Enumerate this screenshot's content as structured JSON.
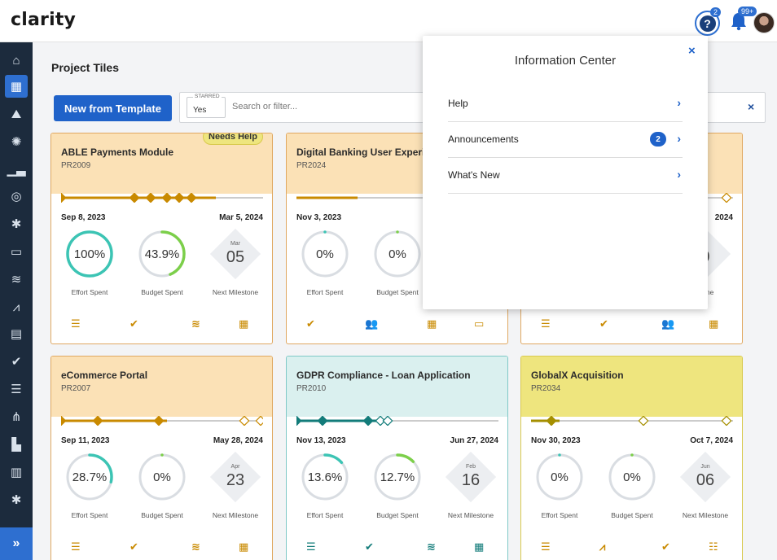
{
  "app": {
    "logo": "clarity",
    "help_badge": "2",
    "notif_badge": "99+"
  },
  "nav": {
    "icons": [
      "home-icon",
      "tiles-icon",
      "landscape-icon",
      "idea-icon",
      "chart-icon",
      "target-icon",
      "asterisk-icon",
      "presentation-icon",
      "database-icon",
      "trend-icon",
      "clipboard-icon",
      "check-icon",
      "list-icon",
      "org-icon",
      "report-icon",
      "map-icon",
      "asterisk-icon"
    ],
    "expand_label": "»"
  },
  "page": {
    "title": "Project Tiles",
    "new_button": "New from Template",
    "starred_label": "STARRED",
    "starred_value": "Yes",
    "search_placeholder": "Search or filter...",
    "clear_icon": "×"
  },
  "cards": [
    {
      "name": "ABLE Payments Module",
      "code": "PR2009",
      "theme": "orange",
      "badge": "Needs Help",
      "start": "Sep 8, 2023",
      "end": "Mar 5, 2024",
      "effort": "100%",
      "effort_frac": 1.0,
      "budget": "43.9%",
      "budget_frac": 0.439,
      "ms_month": "Mar",
      "ms_day": "05",
      "labels": [
        "Effort Spent",
        "Budget Spent",
        "Next Milestone"
      ],
      "icons": [
        "☰",
        "✔",
        "≋",
        "▦"
      ]
    },
    {
      "name": "Digital Banking User Experience",
      "code": "PR2024",
      "theme": "orange",
      "start": "Nov 3, 2023",
      "end": "",
      "effort": "0%",
      "effort_frac": 0,
      "budget": "0%",
      "budget_frac": 0,
      "ms_month": "",
      "ms_day": "",
      "labels": [
        "Effort Spent",
        "Budget Spent",
        ""
      ],
      "icons": [
        "✔",
        "👥",
        "▦",
        "▭"
      ]
    },
    {
      "name": "",
      "code": "",
      "theme": "orange",
      "start": "",
      "end": "2024",
      "effort": "",
      "effort_frac": 0,
      "budget": "",
      "budget_frac": 0,
      "ms_month": "",
      "ms_day": "9",
      "labels": [
        "",
        "",
        "stone"
      ],
      "icons": [
        "☰",
        "✔",
        "👥",
        "▦"
      ]
    },
    {
      "name": "eCommerce Portal",
      "code": "PR2007",
      "theme": "orange",
      "start": "Sep 11, 2023",
      "end": "May 28, 2024",
      "effort": "28.7%",
      "effort_frac": 0.287,
      "budget": "0%",
      "budget_frac": 0,
      "ms_month": "Apr",
      "ms_day": "23",
      "labels": [
        "Effort Spent",
        "Budget Spent",
        "Next Milestone"
      ],
      "icons": [
        "☰",
        "✔",
        "≋",
        "▦"
      ]
    },
    {
      "name": "GDPR Compliance - Loan Application",
      "code": "PR2010",
      "theme": "teal",
      "start": "Nov 13, 2023",
      "end": "Jun 27, 2024",
      "effort": "13.6%",
      "effort_frac": 0.136,
      "budget": "12.7%",
      "budget_frac": 0.127,
      "ms_month": "Feb",
      "ms_day": "16",
      "labels": [
        "Effort Spent",
        "Budget Spent",
        "Next Milestone"
      ],
      "icons": [
        "☰",
        "✔",
        "≋",
        "▦"
      ]
    },
    {
      "name": "GlobalX Acquisition",
      "code": "PR2034",
      "theme": "yellow",
      "start": "Nov 30, 2023",
      "end": "Oct 7, 2024",
      "effort": "0%",
      "effort_frac": 0,
      "budget": "0%",
      "budget_frac": 0,
      "ms_month": "Jun",
      "ms_day": "06",
      "labels": [
        "Effort Spent",
        "Budget Spent",
        "Next Milestone"
      ],
      "icons": [
        "☰",
        "⩘",
        "✔",
        "☷"
      ]
    }
  ],
  "info_center": {
    "title": "Information Center",
    "close": "×",
    "items": [
      {
        "label": "Help",
        "count": ""
      },
      {
        "label": "Announcements",
        "count": "2"
      },
      {
        "label": "What's New",
        "count": ""
      }
    ],
    "chevron": "›"
  },
  "colors": {
    "accent": "#1f62c9",
    "nav_bg": "#1c2b3d",
    "orange_head": "#fbe1b6",
    "teal_head": "#daf0ef",
    "yellow_head": "#eee57e",
    "effort_ring": "#3cc4b4",
    "budget_ring": "#7ccf4a"
  }
}
